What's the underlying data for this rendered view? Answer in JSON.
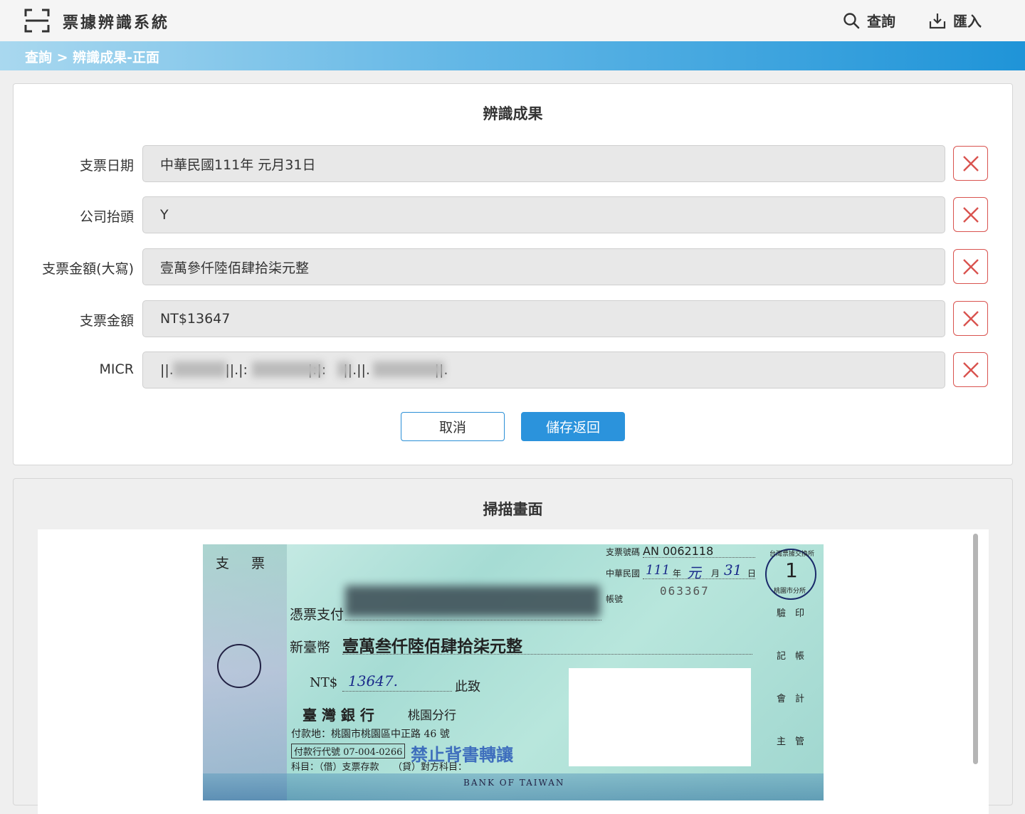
{
  "app": {
    "title": "票據辨識系統",
    "nav": {
      "query_label": "查詢",
      "import_label": "匯入"
    }
  },
  "breadcrumb": "查詢 > 辨識成果-正面",
  "result_panel": {
    "title": "辨識成果",
    "fields": [
      {
        "label": "支票日期",
        "value": "中華民國111年 元月31日"
      },
      {
        "label": "公司抬頭",
        "value": "Y"
      },
      {
        "label": "支票金額(大寫)",
        "value": "壹萬參仟陸佰肆拾柒元整"
      },
      {
        "label": "支票金額",
        "value": "NT$13647"
      },
      {
        "label": "MICR",
        "value": "||.            ||.|:              |:|:    ||.||.               ||."
      }
    ],
    "cancel_label": "取消",
    "save_label": "儲存返回"
  },
  "scan_panel": {
    "title": "掃描畫面",
    "cheque": {
      "header_left": "支　票",
      "cheque_no_label": "支票號碼",
      "cheque_no": "AN 0062118",
      "date_prefix": "中華民國",
      "date_year": "111",
      "date_month": "元",
      "date_day": "31",
      "year_unit": "年",
      "month_unit": "月",
      "day_unit": "日",
      "account_label": "帳號",
      "account_no": "063367",
      "pay_to": "憑票支付",
      "amount_label": "新臺幣",
      "amount_words": "壹萬叁仟陸佰肆拾柒元整",
      "nt_label": "NT$",
      "nt_amount": "13647.",
      "ci_zhi": "此致",
      "bank_name": "臺 灣 銀 行",
      "branch": "桃園分行",
      "pay_place": "付款地：桃園市桃園區中正路 46 號",
      "bank_code": "付款行代號 07-004-0266",
      "subject": "科目：（借）支票存款　　（貸）對方科目：",
      "no_endorse": "禁止背書轉讓",
      "bank_en": "BANK OF TAIWAN",
      "stamp_number": "1",
      "stamp_top": "台灣票據交換所",
      "stamp_bottom": "桃園市分所",
      "side_verify": "驗　印",
      "side_book": "記　帳",
      "side_account": "會　計",
      "side_manager": "主　管"
    }
  }
}
